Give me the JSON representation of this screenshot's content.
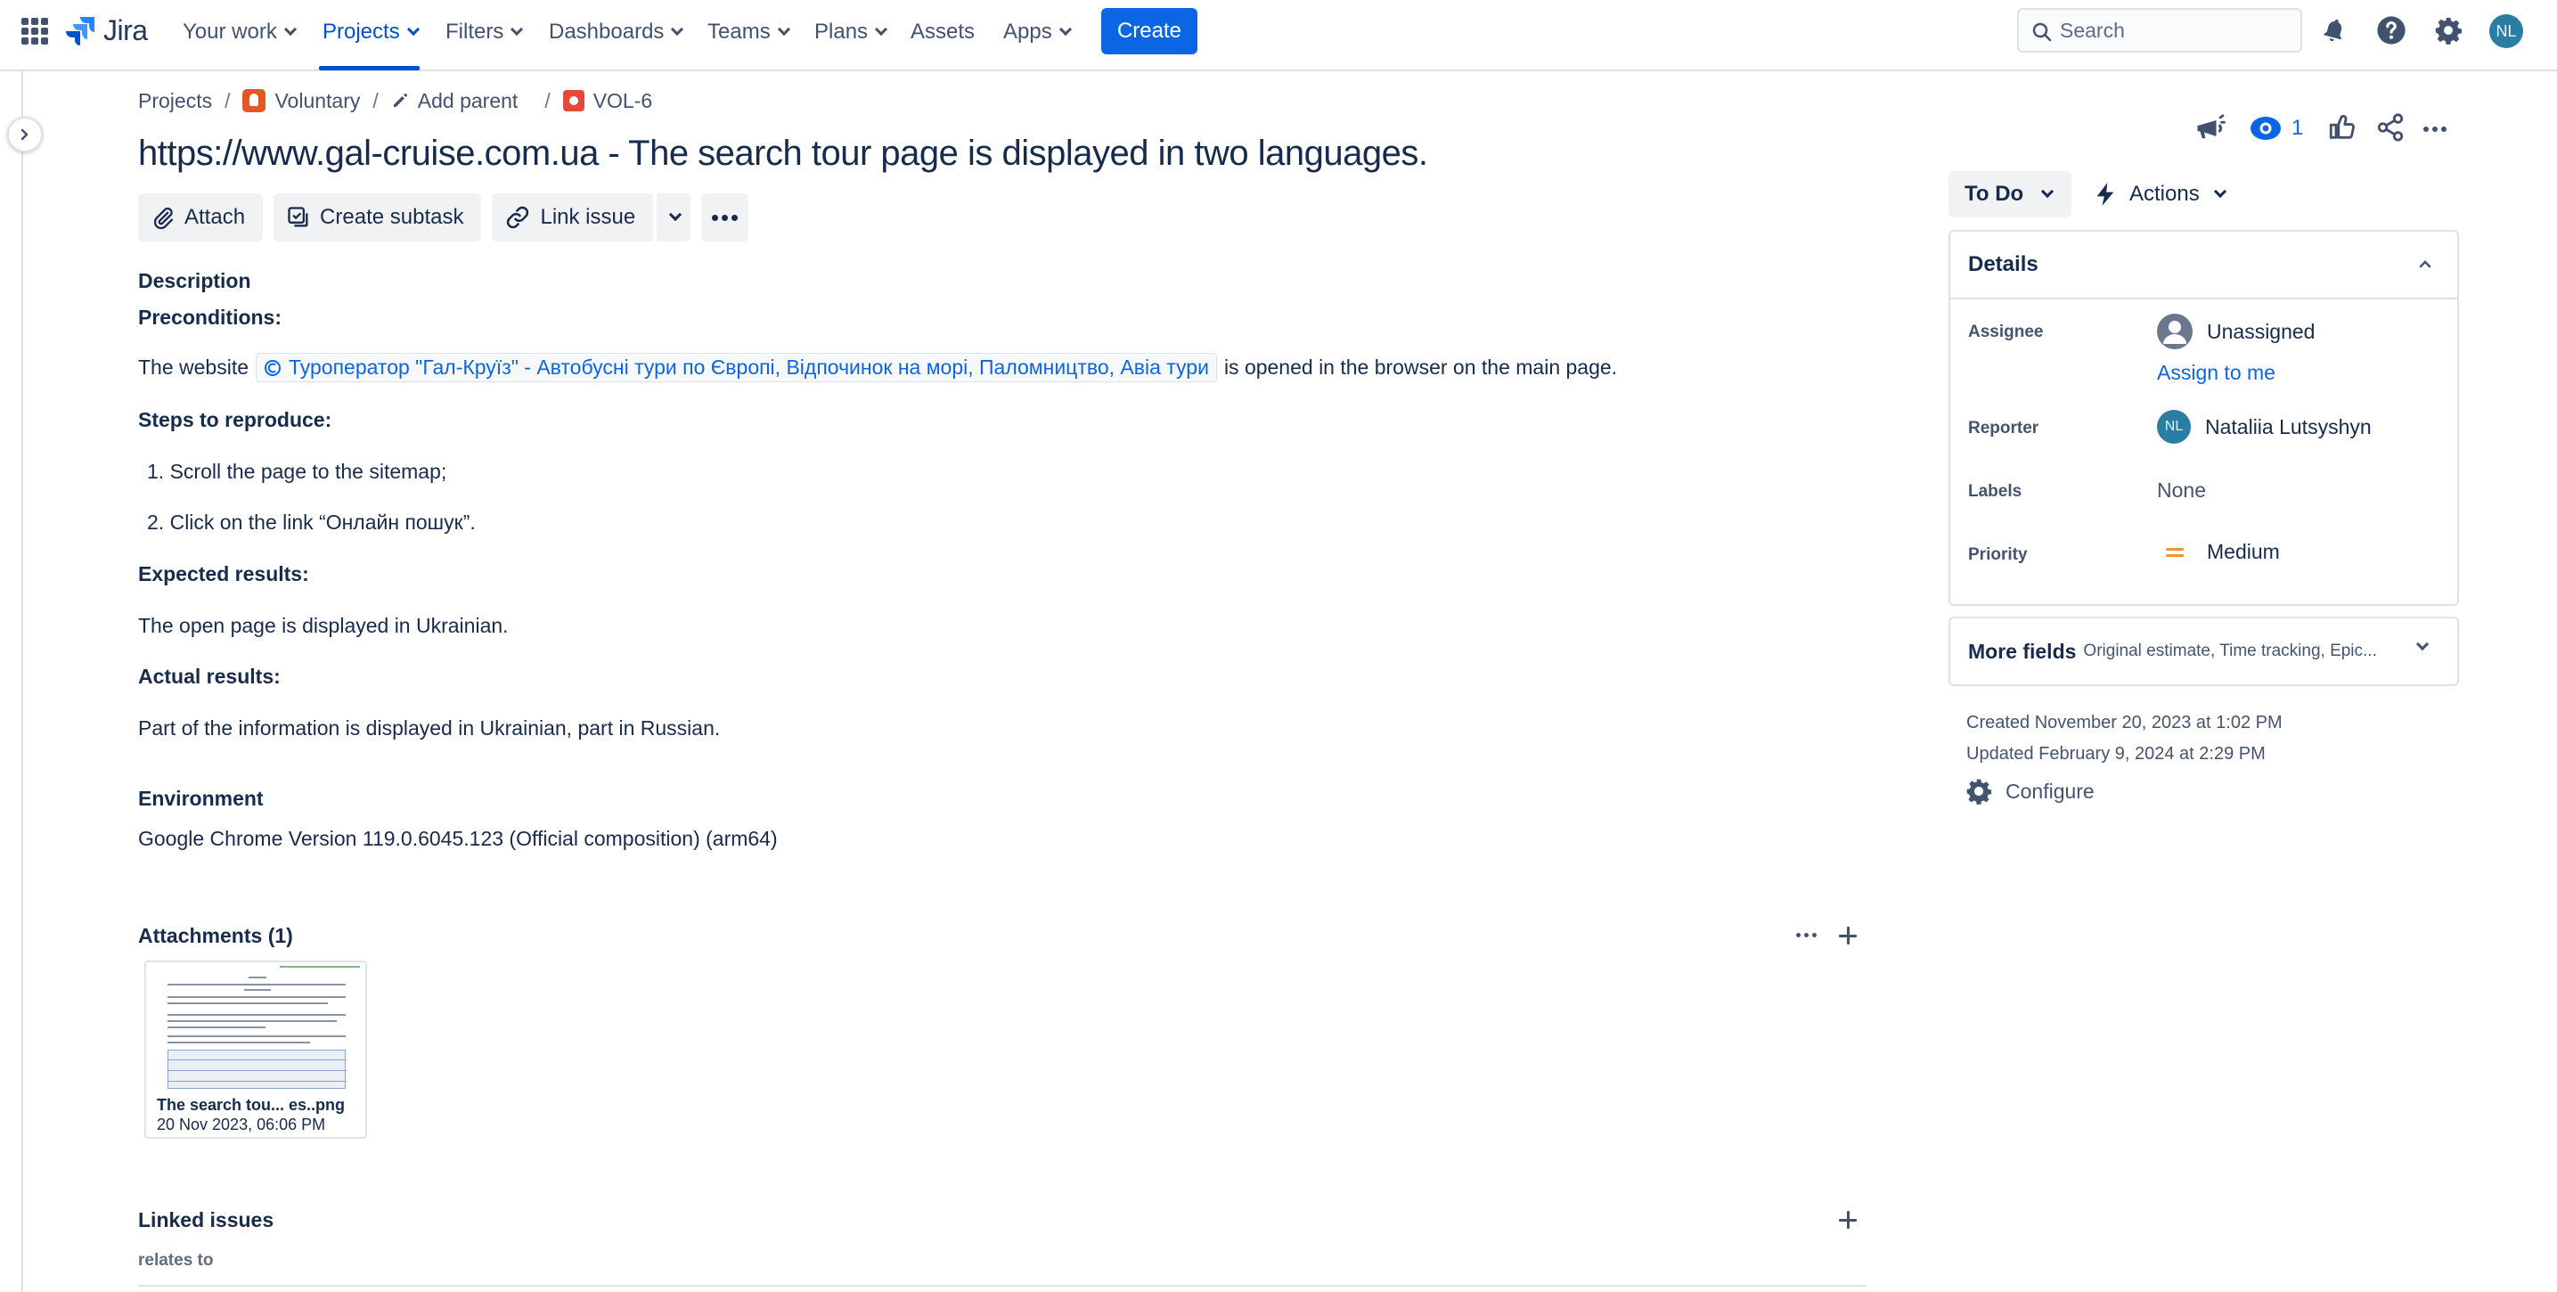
{
  "app": {
    "name": "Jira"
  },
  "nav": {
    "items": [
      "Your work",
      "Projects",
      "Filters",
      "Dashboards",
      "Teams",
      "Plans",
      "Assets",
      "Apps"
    ],
    "create_label": "Create",
    "search_placeholder": "Search",
    "user_initials": "NL"
  },
  "breadcrumb": {
    "projects": "Projects",
    "project": "Voluntary",
    "add_parent": "Add parent",
    "issue_key": "VOL-6"
  },
  "issue": {
    "title": "https://www.gal-cruise.com.ua - The search tour page is displayed in two languages.",
    "watchers_count": "1"
  },
  "toolbar": {
    "attach": "Attach",
    "create_subtask": "Create subtask",
    "link_issue": "Link issue"
  },
  "description": {
    "heading": "Description",
    "preconditions_label": "Preconditions:",
    "website_prefix": "The website",
    "website_link": "Туроператор \"Гал-Круїз\" - Автобусні тури по Європі, Відпочинок на морі, Паломництво, Авіа тури",
    "website_suffix": "is opened in the browser on the main page.",
    "steps_label": "Steps to reproduce:",
    "steps": [
      "Scroll the page to the sitemap;",
      "Click on the link “Онлайн пошук”."
    ],
    "expected_label": "Expected results:",
    "expected": "The open page is displayed in Ukrainian.",
    "actual_label": "Actual results:",
    "actual": "Part of the information is displayed in Ukrainian, part in Russian."
  },
  "environment": {
    "heading": "Environment",
    "value": "Google Chrome Version 119.0.6045.123 (Official composition) (arm64)"
  },
  "attachments": {
    "heading": "Attachments (1)",
    "items": [
      {
        "name": "The search tou... es..png",
        "date": "20 Nov 2023, 06:06 PM"
      }
    ]
  },
  "linked": {
    "heading": "Linked issues",
    "relation": "relates to"
  },
  "side": {
    "status": "To Do",
    "actions": "Actions",
    "details_heading": "Details",
    "fields": {
      "assignee_label": "Assignee",
      "assignee_value": "Unassigned",
      "assign_to_me": "Assign to me",
      "reporter_label": "Reporter",
      "reporter_value": "Nataliia Lutsyshyn",
      "reporter_initials": "NL",
      "labels_label": "Labels",
      "labels_value": "None",
      "priority_label": "Priority",
      "priority_value": "Medium"
    },
    "more_fields_label": "More fields",
    "more_fields_hint": "Original estimate, Time tracking, Epic...",
    "created": "Created November 20, 2023 at 1:02 PM",
    "updated": "Updated February 9, 2024 at 2:29 PM",
    "configure": "Configure"
  },
  "colors": {
    "accent": "#0052cc",
    "create_button": "#0c66e4",
    "bug": "#e5493a",
    "project": "#e25822",
    "priority_medium": "#f79233"
  }
}
